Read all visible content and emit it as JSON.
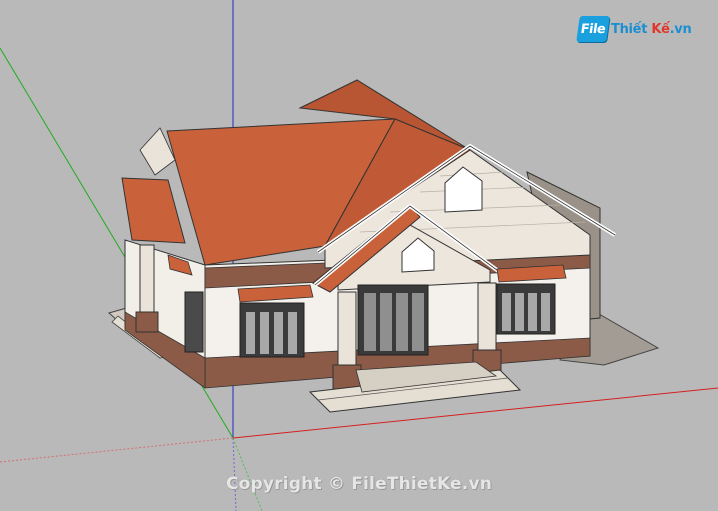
{
  "watermark": {
    "logo_badge": "File",
    "logo_brand": "Thiết",
    "logo_accent": "Kế",
    "logo_suffix": ".vn",
    "copyright": "Copyright © FileThietKe.vn"
  },
  "model": {
    "subject": "house-3d-model",
    "colors": {
      "background": "#b9b9b9",
      "roof": "#c8603a",
      "wall": "#f4f1ec",
      "trim": "#ffffff",
      "accent_band": "#8a5a4a",
      "window_frame": "#3a3a3a",
      "axis_red": "#d62020",
      "axis_green": "#1fa51f",
      "axis_blue": "#2020d0"
    }
  }
}
